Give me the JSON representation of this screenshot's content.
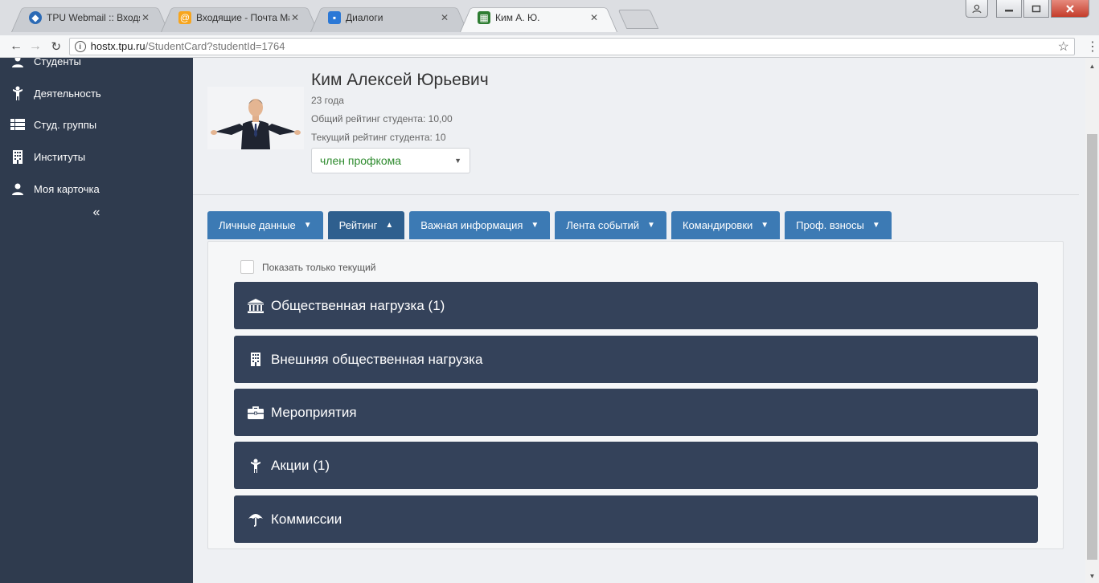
{
  "browser": {
    "tabs": [
      {
        "title": "TPU Webmail :: Входящи",
        "active": false
      },
      {
        "title": "Входящие - Почта Mail.",
        "active": false
      },
      {
        "title": "Диалоги",
        "active": false
      },
      {
        "title": "Ким А. Ю.",
        "active": true
      }
    ],
    "close_glyph": "✕",
    "url_host": "hostx.tpu.ru",
    "url_path": "/StudentCard?studentId=1764"
  },
  "sidebar": {
    "items": [
      {
        "label": "Студенты",
        "icon": "user-icon"
      },
      {
        "label": "Деятельность",
        "icon": "person-icon"
      },
      {
        "label": "Студ. группы",
        "icon": "list-icon"
      },
      {
        "label": "Институты",
        "icon": "building-icon"
      },
      {
        "label": "Моя карточка",
        "icon": "user-icon"
      }
    ],
    "collapse_label": "«"
  },
  "student": {
    "name": "Ким Алексей Юрьевич",
    "age": "23 года",
    "total_rating": "Общий рейтинг студента: 10,00",
    "current_rating": "Текущий рейтинг студента: 10",
    "status": "член профкома"
  },
  "profile_tabs": [
    {
      "label": "Личные данные",
      "chevron": "▼",
      "active": false
    },
    {
      "label": "Рейтинг",
      "chevron": "▲",
      "active": true
    },
    {
      "label": "Важная информация",
      "chevron": "▼",
      "active": false
    },
    {
      "label": "Лента событий",
      "chevron": "▼",
      "active": false
    },
    {
      "label": "Командировки",
      "chevron": "▼",
      "active": false
    },
    {
      "label": "Проф. взносы",
      "chevron": "▼",
      "active": false
    }
  ],
  "rating": {
    "show_current_only_label": "Показать только текущий",
    "sections": [
      {
        "label": "Общественная нагрузка (1)",
        "icon": "institution-icon"
      },
      {
        "label": "Внешняя общественная нагрузка",
        "icon": "building-icon"
      },
      {
        "label": "Мероприятия",
        "icon": "briefcase-icon"
      },
      {
        "label": "Акции (1)",
        "icon": "person-icon"
      },
      {
        "label": "Коммиссии",
        "icon": "umbrella-icon"
      }
    ]
  },
  "colors": {
    "sidebar_bg": "#2f3b4e",
    "tab_blue": "#3c7ab4",
    "tab_active": "#2e5f8e",
    "accordion_bg": "#34425a",
    "status_green": "#2e8b2e"
  }
}
